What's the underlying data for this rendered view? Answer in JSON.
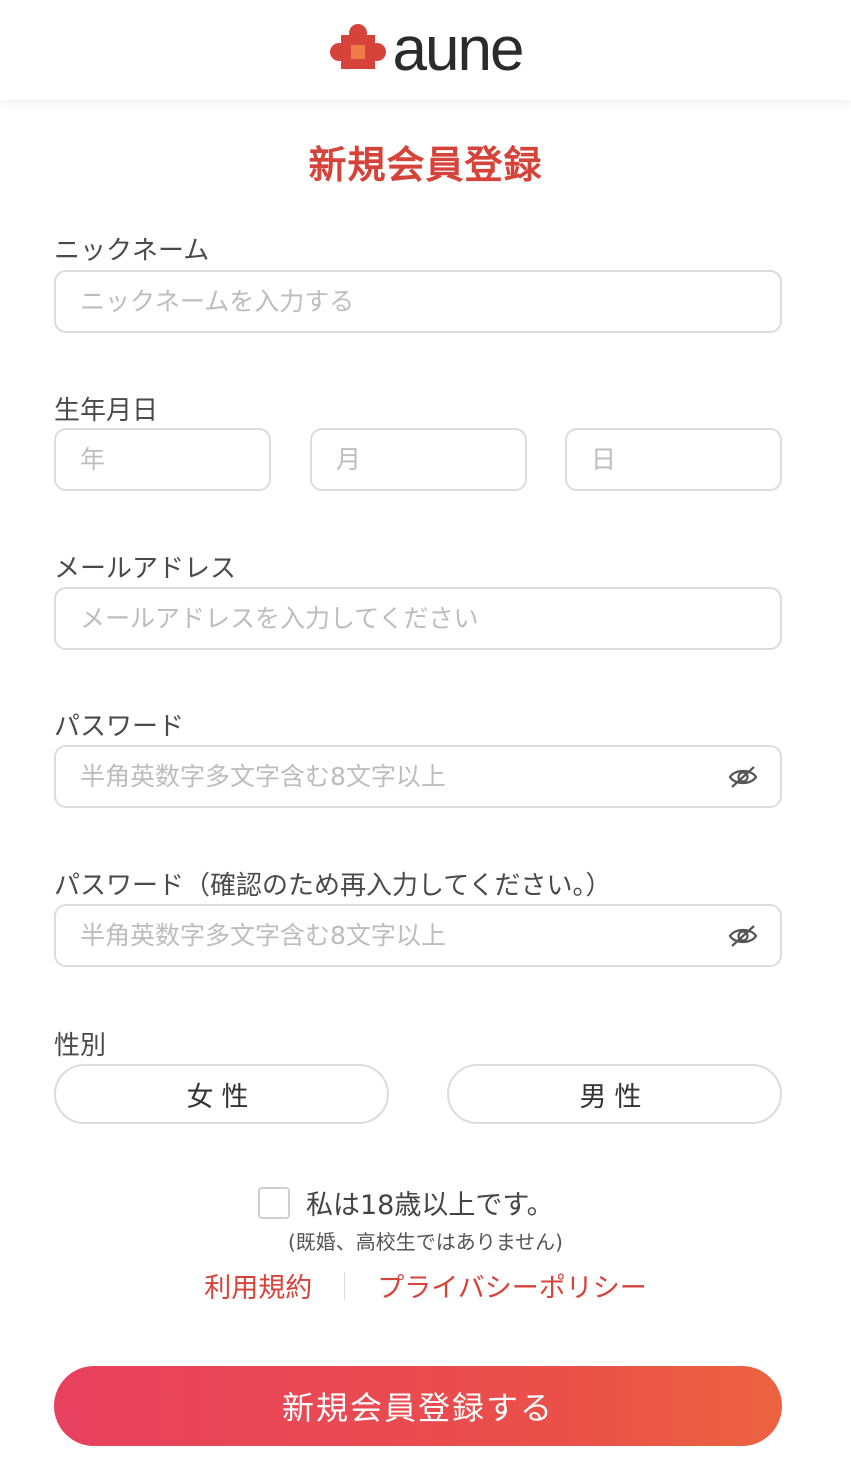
{
  "header": {
    "logo_text": "aune",
    "logo_icon": "puzzle-piece-icon",
    "brand_color": "#d6433a"
  },
  "page_title": "新規会員登録",
  "nickname": {
    "label": "ニックネーム",
    "placeholder": "ニックネームを入力する",
    "value": ""
  },
  "birthday": {
    "label": "生年月日",
    "year_placeholder": "年",
    "month_placeholder": "月",
    "day_placeholder": "日"
  },
  "email": {
    "label": "メールアドレス",
    "placeholder": "メールアドレスを入力してください",
    "value": ""
  },
  "password": {
    "label": "パスワード",
    "placeholder": "半角英数字多文字含む8文字以上",
    "toggle_icon": "eye-off-icon"
  },
  "password_confirm": {
    "label": "パスワード（確認のため再入力してください。）",
    "placeholder": "半角英数字多文字含む8文字以上",
    "toggle_icon": "eye-off-icon"
  },
  "gender": {
    "label": "性別",
    "female": "女性",
    "male": "男性"
  },
  "agreement": {
    "checked": false,
    "text": "私は18歳以上です。",
    "note": "(既婚、高校生ではありません)"
  },
  "links": {
    "terms": "利用規約",
    "privacy": "プライバシーポリシー"
  },
  "submit": {
    "label": "新規会員登録する",
    "gradient_start": "#e8405f",
    "gradient_end": "#ec6340"
  }
}
